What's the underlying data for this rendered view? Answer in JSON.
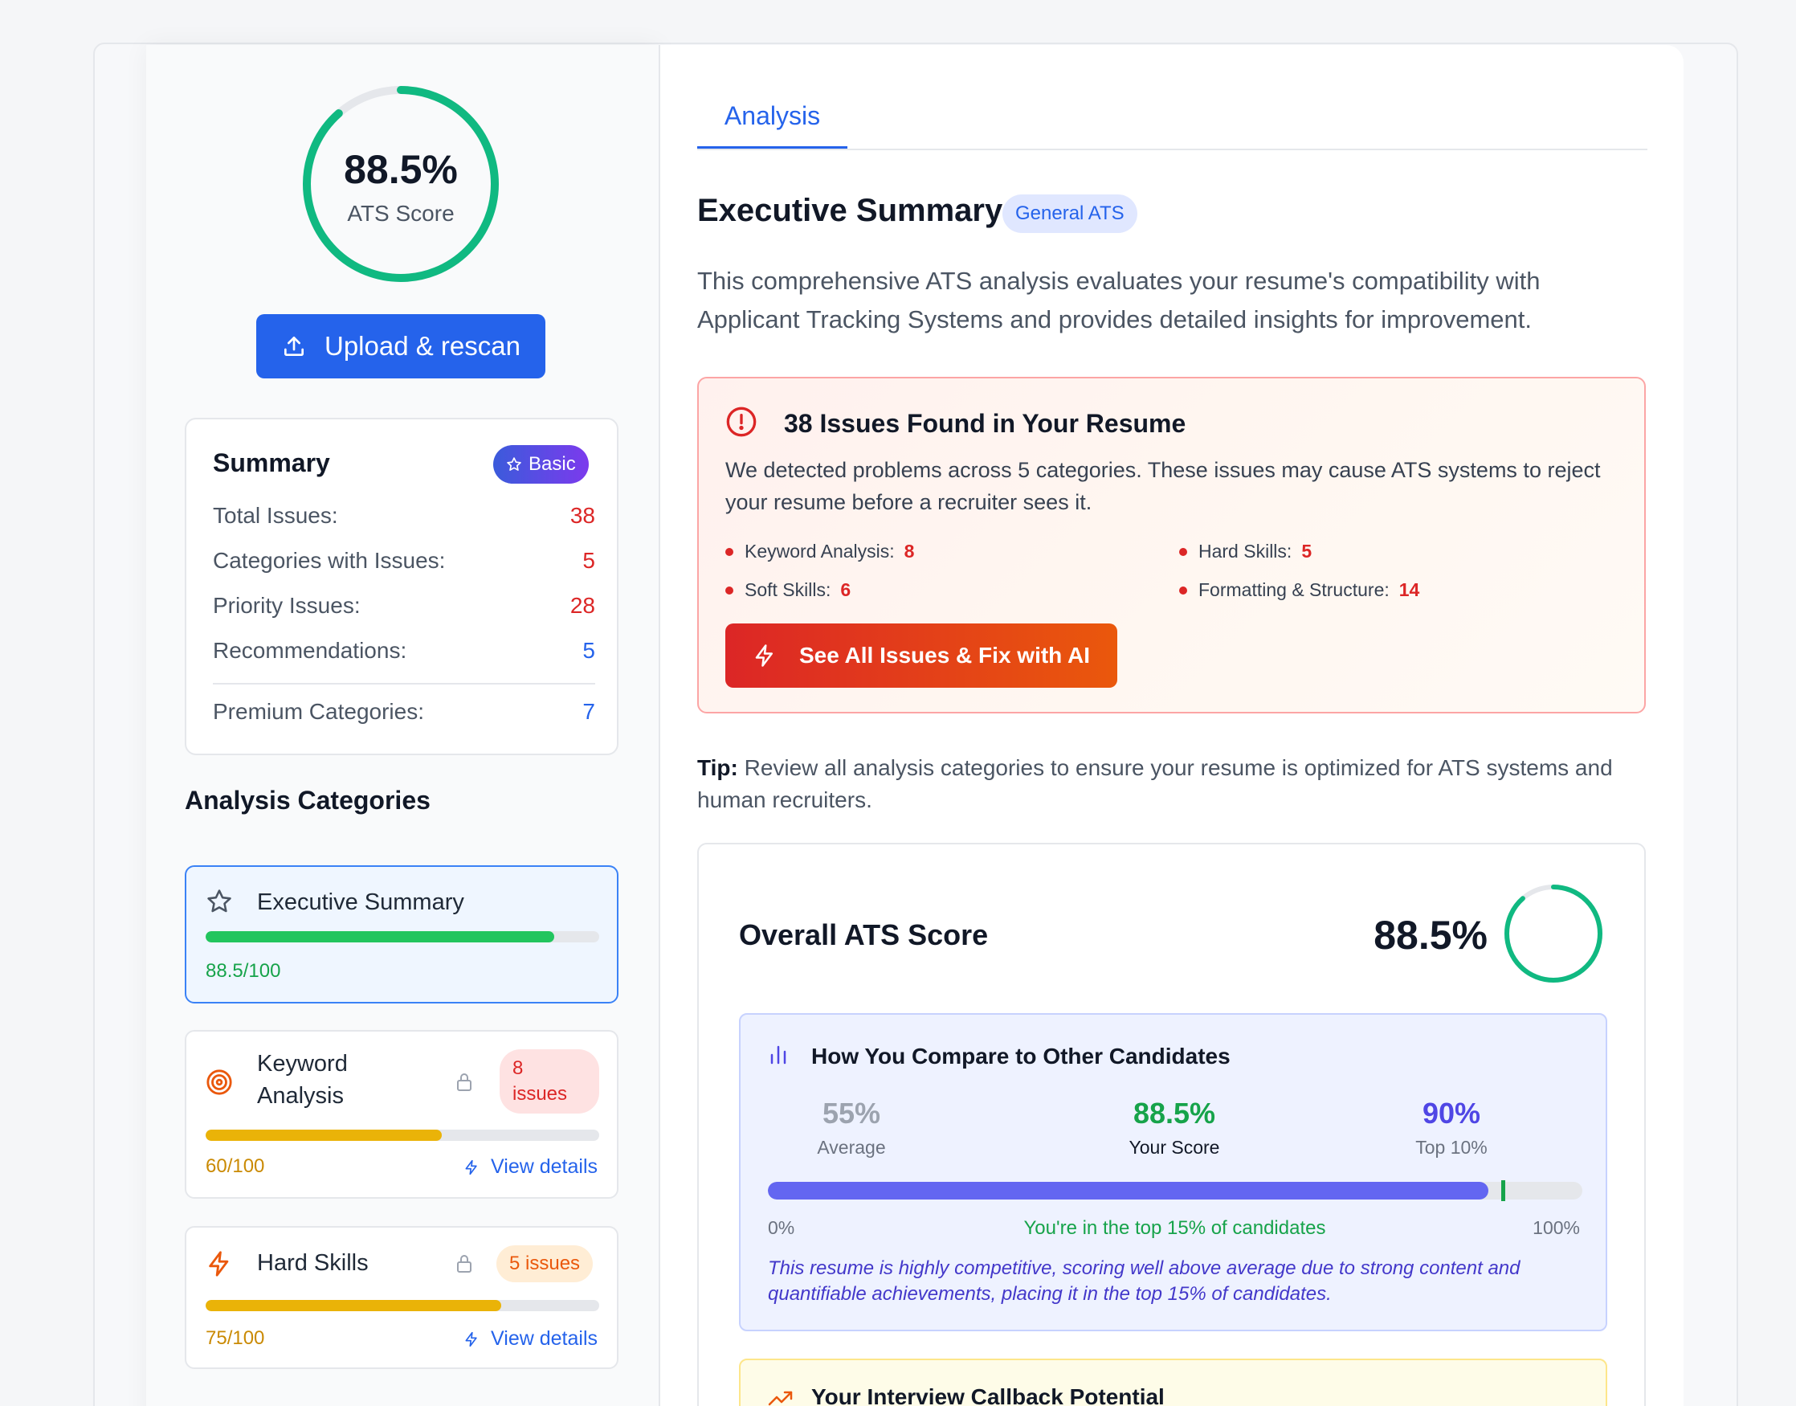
{
  "sidebar": {
    "score": {
      "value": "88.5%",
      "label": "ATS Score",
      "fraction": 0.885
    },
    "upload_label": "Upload & rescan",
    "summary": {
      "title": "Summary",
      "badge": "Basic",
      "rows": [
        {
          "label": "Total Issues:",
          "value": "38"
        },
        {
          "label": "Categories with Issues:",
          "value": "5"
        },
        {
          "label": "Priority Issues:",
          "value": "28"
        },
        {
          "label": "Recommendations:",
          "value": "5"
        }
      ],
      "premium": {
        "label": "Premium Categories:",
        "value": "7"
      }
    },
    "categories_heading": "Analysis Categories",
    "categories": [
      {
        "name": "Executive Summary",
        "score": "88.5/100",
        "progress": 0.885,
        "color": "#22c55e",
        "icon": "star-icon"
      },
      {
        "name_line1": "Keyword",
        "name_line2": "Analysis",
        "score": "60/100",
        "progress": 0.6,
        "color": "#eab308",
        "icon": "target-icon",
        "issues_line1": "8",
        "issues_line2": "issues",
        "view": "View details"
      },
      {
        "name": "Hard Skills",
        "score": "75/100",
        "progress": 0.75,
        "color": "#eab308",
        "icon": "bolt-icon",
        "issues": "5 issues",
        "view": "View details"
      }
    ]
  },
  "main": {
    "tab": "Analysis",
    "title": "Executive Summary",
    "badge": "General ATS",
    "description": "This comprehensive ATS analysis evaluates your resume's compatibility with Applicant Tracking Systems and provides detailed insights for improvement.",
    "issues_box": {
      "title": "38 Issues Found in Your Resume",
      "description": "We detected problems across 5 categories. These issues may cause ATS systems to reject your resume before a recruiter sees it.",
      "items": [
        {
          "label": "Keyword Analysis:",
          "count": "8"
        },
        {
          "label": "Hard Skills:",
          "count": "5"
        },
        {
          "label": "Soft Skills:",
          "count": "6"
        },
        {
          "label": "Formatting & Structure:",
          "count": "14"
        }
      ],
      "button": "See All Issues & Fix with AI"
    },
    "tip": {
      "label": "Tip:",
      "text": " Review all analysis categories to ensure your resume is optimized for ATS systems and human recruiters."
    },
    "overall": {
      "title": "Overall ATS Score",
      "value": "88.5%",
      "fraction": 0.885,
      "compare": {
        "title": "How You Compare to Other Candidates",
        "stats": [
          {
            "value": "55%",
            "label": "Average",
            "color": "#9ca3af"
          },
          {
            "value": "88.5%",
            "label": "Your Score",
            "color": "#16a34a"
          },
          {
            "value": "90%",
            "label": "Top 10%",
            "color": "#4f46e5"
          }
        ],
        "bar_fill": 0.885,
        "marker": 0.9,
        "min": "0%",
        "max": "100%",
        "mid": "You're in the top 15% of candidates",
        "note": "This resume is highly competitive, scoring well above average due to strong content and quantifiable achievements, placing it in the top 15% of candidates."
      },
      "callback_title": "Your Interview Callback Potential"
    }
  }
}
